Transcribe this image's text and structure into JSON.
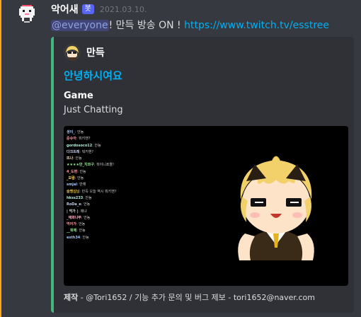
{
  "message": {
    "username": "악어새",
    "bot_tag": "봇",
    "timestamp": "2021.03.10.",
    "mention": "@everyone",
    "text": "! 만득 방송 ON ! ",
    "link": "https://www.twitch.tv/esstree"
  },
  "embed": {
    "author": "만득",
    "title": "안녕하시여요",
    "field_name": "Game",
    "field_value": "Just Chatting",
    "footer_bold": "제작",
    "footer_rest": " - @Tori1652 / 기능 추가 문의 및 버그 제보 - tori1652@naver.com",
    "accent_color": "#43b581",
    "chat": [
      {
        "name": "생이_",
        "msg": ": 안뇽",
        "color": "#a0c4ff"
      },
      {
        "name": "준슈아",
        "msg": ": 뭐키핸?",
        "color": "#ff9aa2"
      },
      {
        "name": "gordosoco12",
        "msg": ": 안뇽",
        "color": "#b5ead7"
      },
      {
        "name": "다크트레",
        "msg": ": 뭐키핸?",
        "color": "#c7ceea"
      },
      {
        "name": "뜨나",
        "msg": ": 안뇽",
        "color": "#ffdac1"
      },
      {
        "name": "★★★★만_치와구",
        "msg": ": 뭐야니죠몰!",
        "color": "#9be89b"
      },
      {
        "name": "4_도편",
        "msg": ": 안뇽",
        "color": "#ff9aa2"
      },
      {
        "name": "_모람",
        "msg": ": 안뇽",
        "color": "#ffd166"
      },
      {
        "name": "smjal",
        "msg": ": 반해",
        "color": "#a0c4ff"
      },
      {
        "name": "슬쩡심님",
        "msg": ": 만득 오늘 역시 뭐키핸?",
        "color": "#e2c044"
      },
      {
        "name": "hkss233",
        "msg": ": 안뇽",
        "color": "#b5ead7"
      },
      {
        "name": "RoDa_e",
        "msg": ": 안뇽",
        "color": "#c7ceea"
      },
      {
        "name": "| 먹가 |",
        "msg": ": 매냐",
        "color": "#dddddd"
      },
      {
        "name": "_애화나무",
        "msg": ": 안뇽",
        "color": "#ffb3c6"
      },
      {
        "name": "먹어가",
        "msg": ": 안뇽",
        "color": "#ff9aa2"
      },
      {
        "name": "__뭐에",
        "msg": ": 안뇽",
        "color": "#9be89b"
      },
      {
        "name": "esth34",
        "msg": ": 안뇽",
        "color": "#a0c4ff"
      }
    ]
  }
}
